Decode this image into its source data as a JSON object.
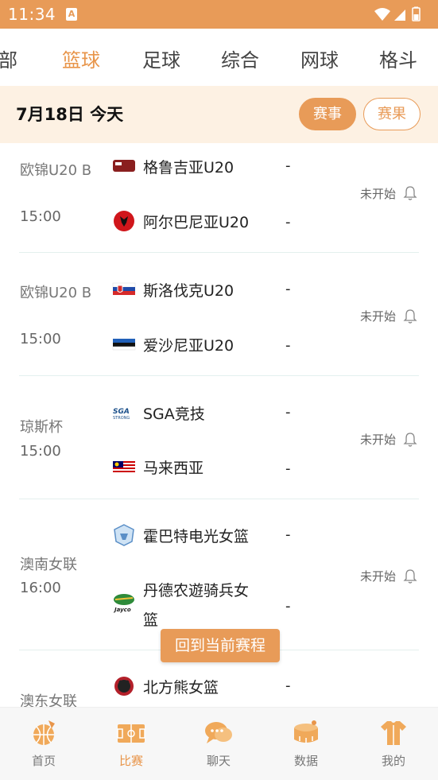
{
  "status_bar": {
    "time": "11:34",
    "app_icon_letter": "A"
  },
  "top_tabs": [
    {
      "label": "全部",
      "shown": "部"
    },
    {
      "label": "篮球"
    },
    {
      "label": "足球"
    },
    {
      "label": "综合"
    },
    {
      "label": "网球"
    },
    {
      "label": "格斗"
    }
  ],
  "date_bar": {
    "date": "7月18日 今天",
    "tab_events": "赛事",
    "tab_results": "赛果"
  },
  "matches": [
    {
      "league": "欧锦U20 B",
      "time": "15:00",
      "home": {
        "name": "格鲁吉亚U20",
        "score": "-"
      },
      "away": {
        "name": "阿尔巴尼亚U20",
        "score": "-"
      },
      "status": "未开始"
    },
    {
      "league": "欧锦U20 B",
      "time": "15:00",
      "home": {
        "name": "斯洛伐克U20",
        "score": "-"
      },
      "away": {
        "name": "爱沙尼亚U20",
        "score": "-"
      },
      "status": "未开始"
    },
    {
      "league": "琼斯杯",
      "time": "15:00",
      "home": {
        "name": "SGA竞技",
        "score": "-"
      },
      "away": {
        "name": "马来西亚",
        "score": "-"
      },
      "status": "未开始"
    },
    {
      "league": "澳南女联",
      "time": "16:00",
      "home": {
        "name": "霍巴特电光女篮",
        "score": "-"
      },
      "away": {
        "name": "丹德农遊骑兵女",
        "name_line2": "篮",
        "score": "-"
      },
      "status": "未开始"
    },
    {
      "league": "澳东女联",
      "home": {
        "name": "北方熊女篮",
        "score": "-"
      }
    }
  ],
  "back_button": "回到当前赛程",
  "bottom_nav": [
    {
      "label": "首页",
      "icon": "home-basketball-icon"
    },
    {
      "label": "比赛",
      "icon": "court-icon"
    },
    {
      "label": "聊天",
      "icon": "chat-icon"
    },
    {
      "label": "数据",
      "icon": "stadium-icon"
    },
    {
      "label": "我的",
      "icon": "jersey-icon"
    }
  ],
  "colors": {
    "accent": "#e89b58",
    "date_bar_bg": "#fdf1e3",
    "active_tab": "#e8954a"
  }
}
